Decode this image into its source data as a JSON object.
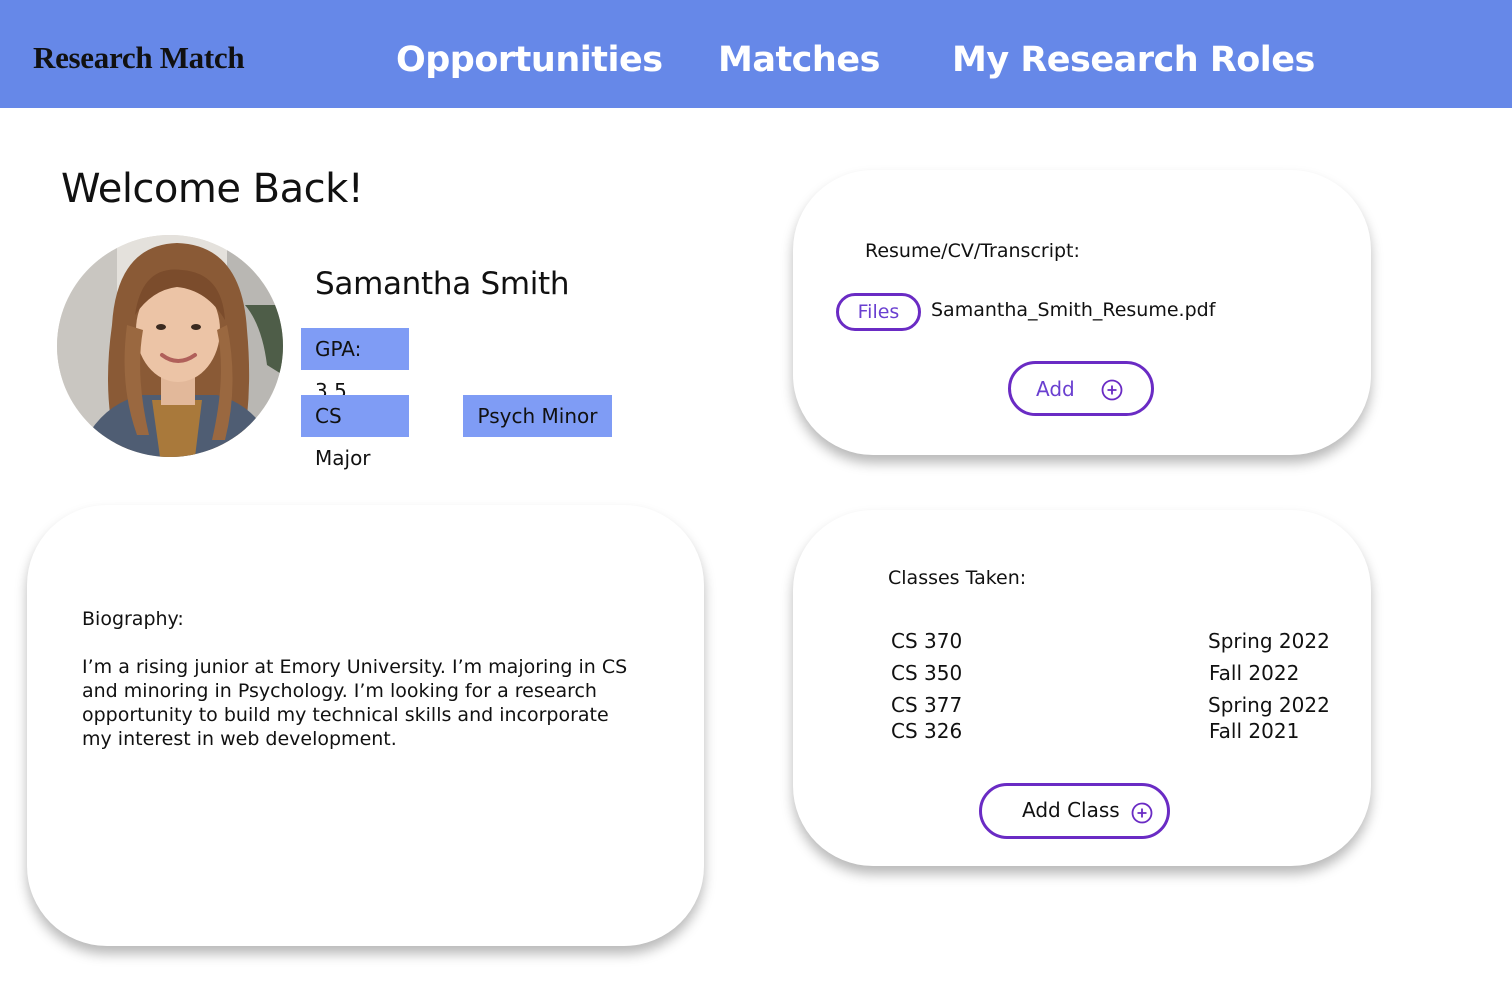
{
  "header": {
    "brand": "Research Match",
    "nav": [
      "Opportunities",
      "Matches",
      "My Research Roles"
    ],
    "background": "#6688e8"
  },
  "profile": {
    "welcome": "Welcome Back!",
    "name": "Samantha Smith",
    "gpa": "GPA: 3.5",
    "major": "CS Major",
    "minor": "Psych Minor",
    "tag_color": "#7f9cf5"
  },
  "documents": {
    "label": "Resume/CV/Transcript:",
    "files_button": "Files",
    "file_name": "Samantha_Smith_Resume.pdf",
    "add_button": "Add",
    "add_icon": "plus-circle-icon"
  },
  "biography": {
    "label": "Biography:",
    "text": "I’m a rising junior at Emory University. I’m majoring in CS and minoring in Psychology. I’m looking for a research opportunity to build my technical skills and incorporate my interest in web development."
  },
  "classes": {
    "label": "Classes Taken:",
    "rows": [
      {
        "course": "CS 370",
        "term": "Spring 2022"
      },
      {
        "course": "CS 350",
        "term": "Fall 2022"
      },
      {
        "course": "CS 377",
        "term": "Spring 2022"
      },
      {
        "course": "CS 326",
        "term": "Fall 2021"
      }
    ],
    "add_button": "Add Class",
    "add_icon": "plus-circle-icon"
  },
  "accent": "#6a2bc4"
}
